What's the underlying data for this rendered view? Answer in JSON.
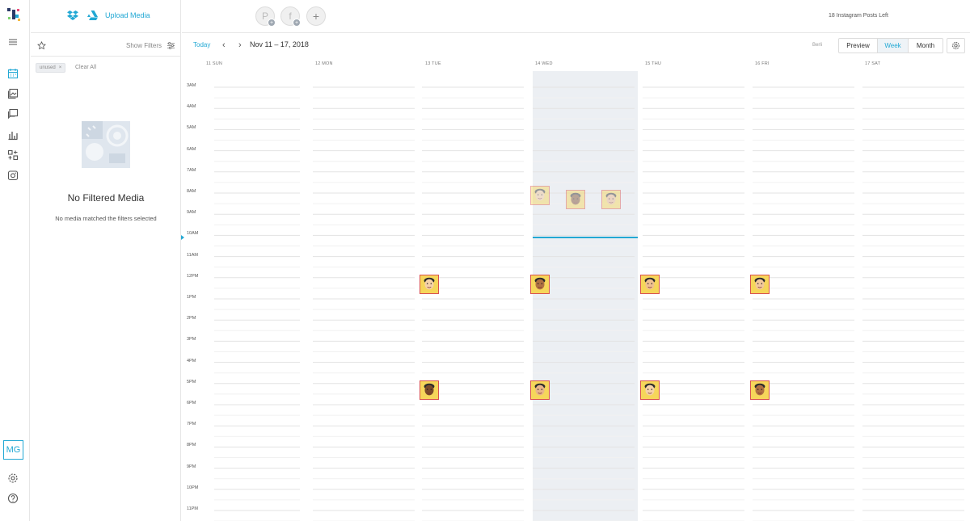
{
  "sidebar": {
    "user_initials": "MG",
    "icons": [
      "logo-icon",
      "menu-icon",
      "calendar-icon",
      "media-library-icon",
      "chat-icon",
      "analytics-icon",
      "linkin-bio-icon",
      "instagram-icon",
      "settings-icon",
      "help-icon"
    ]
  },
  "media_panel": {
    "upload_label": "Upload Media",
    "show_filters_label": "Show Filters",
    "active_filter": "unused",
    "clear_all_label": "Clear All",
    "empty_title": "No Filtered Media",
    "empty_subtitle": "No media matched the filters selected"
  },
  "topbar": {
    "accounts": [
      {
        "type": "pinterest",
        "icon": "pinterest-icon",
        "glyph": "P"
      },
      {
        "type": "facebook",
        "icon": "facebook-icon",
        "glyph": "f"
      }
    ],
    "add_account_glyph": "+",
    "posts_left": "18 Instagram Posts Left"
  },
  "calendar": {
    "today_label": "Today",
    "prev_glyph": "‹",
    "next_glyph": "›",
    "date_range": "Nov 11 – 17, 2018",
    "timezone": "Berli",
    "views": [
      "Preview",
      "Week",
      "Month"
    ],
    "active_view": "Week",
    "days": [
      "11 SUN",
      "12 MON",
      "13 TUE",
      "14 WED",
      "15 THU",
      "16 FRI",
      "17 SAT"
    ],
    "today_index": 3,
    "hours": [
      "3AM",
      "4AM",
      "5AM",
      "6AM",
      "7AM",
      "8AM",
      "9AM",
      "10AM",
      "11AM",
      "12PM",
      "1PM",
      "2PM",
      "3PM",
      "4PM",
      "5PM",
      "6PM",
      "7PM",
      "8PM",
      "9PM",
      "10PM",
      "11PM"
    ],
    "posts": [
      {
        "day": 3,
        "slot": "8AM",
        "state": "past"
      },
      {
        "day": 3,
        "slot": "8AM",
        "state": "past"
      },
      {
        "day": 3,
        "slot": "8AM",
        "state": "past"
      },
      {
        "day": 2,
        "slot": "12PM",
        "state": "scheduled"
      },
      {
        "day": 3,
        "slot": "12PM",
        "state": "scheduled"
      },
      {
        "day": 4,
        "slot": "12PM",
        "state": "scheduled"
      },
      {
        "day": 5,
        "slot": "12PM",
        "state": "scheduled"
      },
      {
        "day": 2,
        "slot": "5PM",
        "state": "scheduled"
      },
      {
        "day": 3,
        "slot": "5PM",
        "state": "scheduled"
      },
      {
        "day": 4,
        "slot": "5PM",
        "state": "scheduled"
      },
      {
        "day": 5,
        "slot": "5PM",
        "state": "scheduled"
      }
    ]
  },
  "colors": {
    "accent": "#22a8d4",
    "post_border": "#d9534f",
    "post_fill": "#f6d65a",
    "today_column": "#eceff3"
  }
}
